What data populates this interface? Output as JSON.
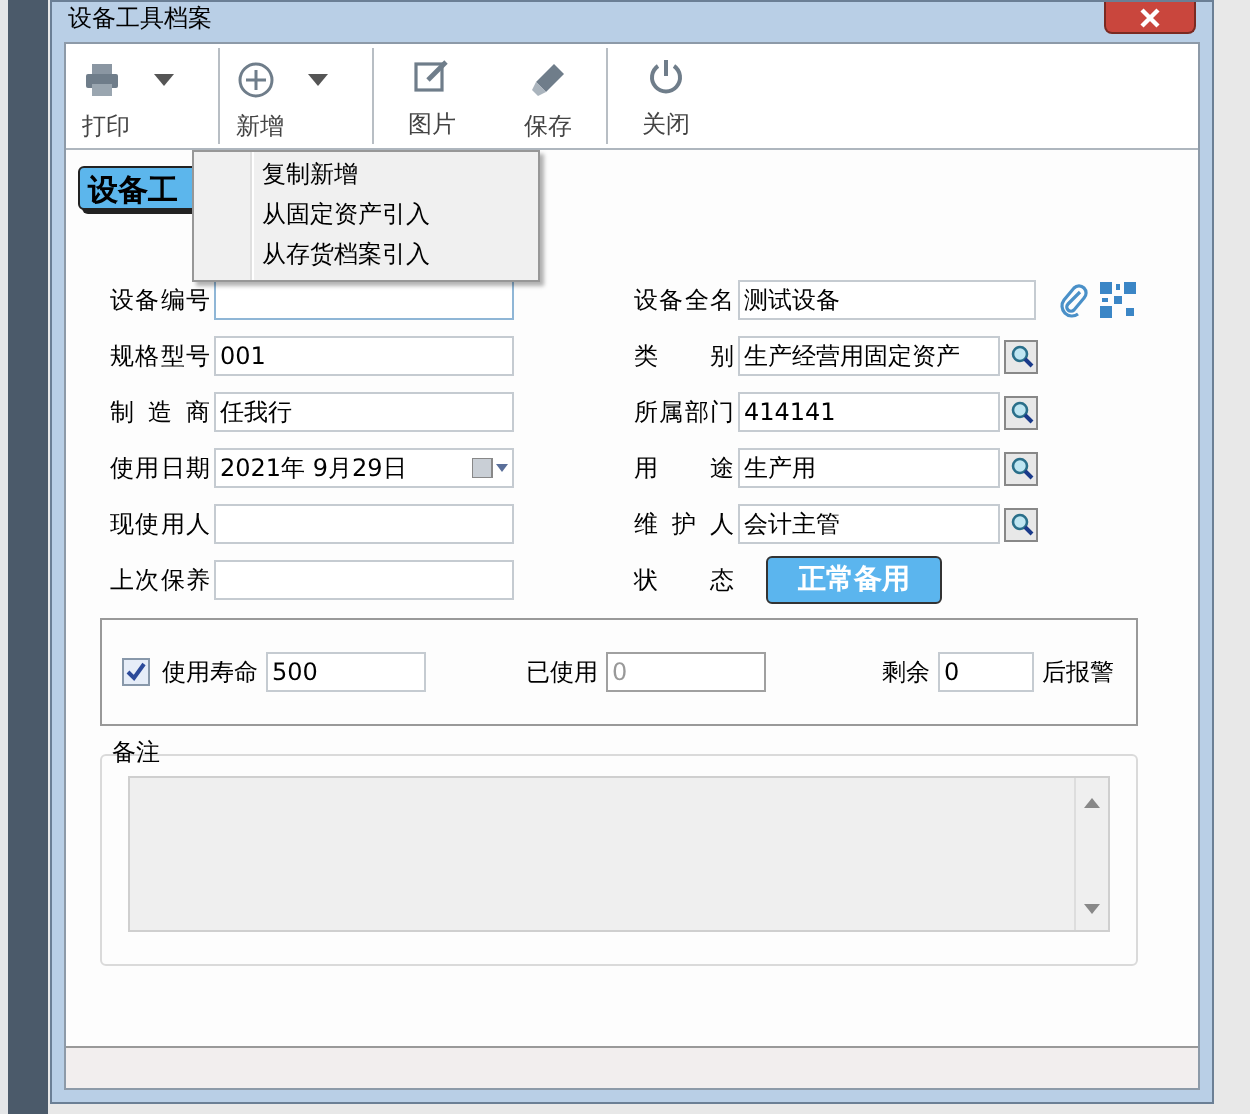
{
  "window": {
    "title": "设备工具档案"
  },
  "toolbar": {
    "buttons": [
      {
        "label": "打印",
        "kind": "print",
        "dropdown": true
      },
      {
        "label": "新增",
        "kind": "add",
        "dropdown": true
      },
      {
        "label": "图片",
        "kind": "picture",
        "dropdown": false
      },
      {
        "label": "保存",
        "kind": "save",
        "dropdown": false
      },
      {
        "label": "关闭",
        "kind": "close",
        "dropdown": false
      }
    ]
  },
  "dropdown_menu": {
    "items": [
      "复制新增",
      "从固定资产引入",
      "从存货档案引入"
    ]
  },
  "heading": "设备工",
  "left_fields": [
    {
      "label": "设备编号",
      "kind": "text"
    },
    {
      "label": "规格型号",
      "value": "001",
      "kind": "text"
    },
    {
      "label": "制 造 商",
      "value": "任我行",
      "kind": "text"
    },
    {
      "label": "使用日期",
      "value": "2021年  9月29日",
      "kind": "date"
    },
    {
      "label": "现使用人",
      "kind": "text"
    },
    {
      "label": "上次保养",
      "kind": "text"
    }
  ],
  "right_fields": [
    {
      "label": "设备全名",
      "value": "测试设备",
      "kind": "text"
    },
    {
      "label": "类 别",
      "value": "生产经营用固定资产",
      "kind": "lookup"
    },
    {
      "label": "所属部门",
      "value": "414141",
      "kind": "lookup"
    },
    {
      "label": "用 途",
      "value": "生产用",
      "kind": "lookup"
    },
    {
      "label": "维 护 人",
      "value": "会计主管",
      "kind": "lookup"
    },
    {
      "label": "状 态",
      "value": "正常备用",
      "kind": "status"
    }
  ],
  "life": {
    "checked": true,
    "label": "使用寿命",
    "value": "500",
    "used_label": "已使用",
    "used_value": "0",
    "remaining_label": "剩余",
    "remaining_value": "0",
    "suffix": "后报警"
  },
  "notes": {
    "label": "备注"
  }
}
